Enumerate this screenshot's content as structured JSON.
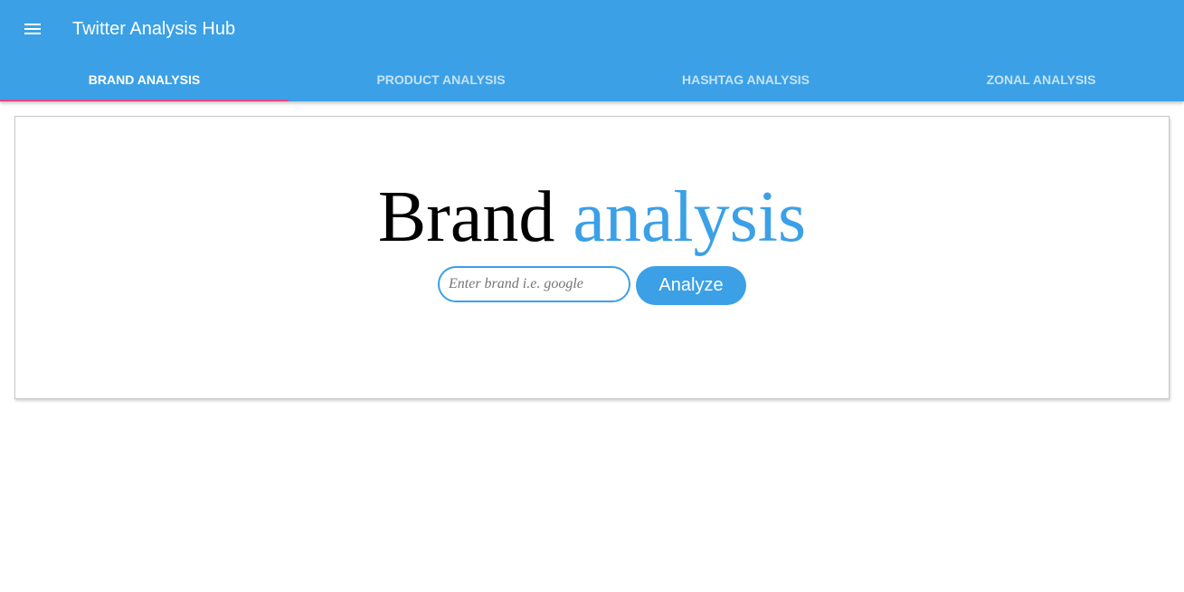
{
  "app": {
    "title": "Twitter Analysis Hub",
    "menu_icon": "menu-icon"
  },
  "tabs": [
    {
      "label": "BRAND ANALYSIS",
      "active": true
    },
    {
      "label": "PRODUCT ANALYSIS",
      "active": false
    },
    {
      "label": "HASHTAG ANALYSIS",
      "active": false
    },
    {
      "label": "ZONAL ANALYSIS",
      "active": false
    }
  ],
  "main": {
    "heading_part1": "Brand",
    "heading_part2": "analysis",
    "search": {
      "placeholder": "Enter brand i.e. google",
      "value": ""
    },
    "analyze_label": "Analyze"
  },
  "colors": {
    "primary": "#3ba0e6",
    "tab_indicator": "#ff4081",
    "heading_accent": "#3ba0e6"
  }
}
